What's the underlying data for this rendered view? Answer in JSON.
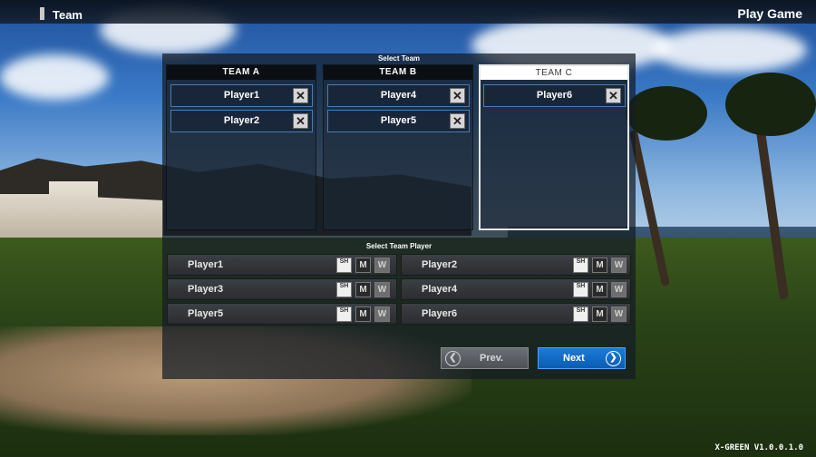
{
  "header": {
    "title": "Team",
    "right_title": "Play Game"
  },
  "select_team": {
    "title": "Select Team",
    "teams": [
      {
        "name": "TEAM A",
        "players": [
          "Player1",
          "Player2"
        ]
      },
      {
        "name": "TEAM B",
        "players": [
          "Player4",
          "Player5"
        ]
      },
      {
        "name": "TEAM C",
        "players": [
          "Player6"
        ],
        "selected": true
      }
    ]
  },
  "select_player": {
    "title": "Select Team Player",
    "players": [
      "Player1",
      "Player2",
      "Player3",
      "Player4",
      "Player5",
      "Player6"
    ],
    "chip_labels": {
      "sh": "SH",
      "m": "M",
      "w": "W"
    }
  },
  "buttons": {
    "prev": "Prev.",
    "next": "Next"
  },
  "version": "X-GREEN V1.0.0.1.0",
  "colors": {
    "accent": "#0b5cb2",
    "slot_border": "#4c7bb0"
  }
}
